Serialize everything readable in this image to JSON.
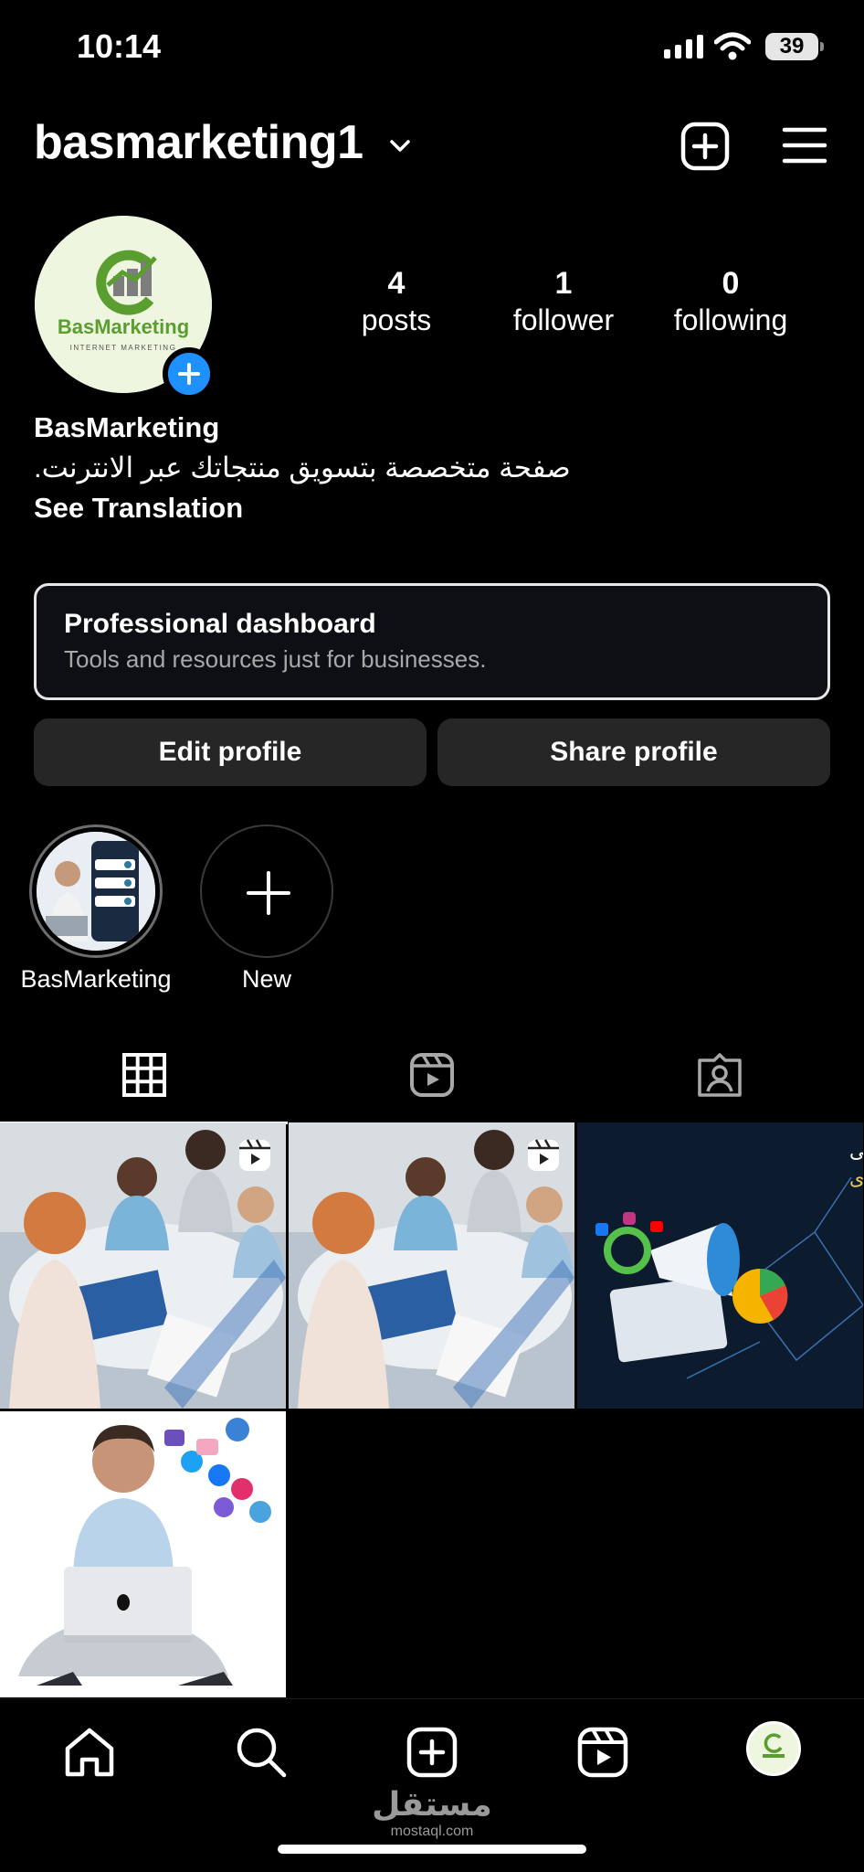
{
  "status_bar": {
    "time": "10:14",
    "battery": "39"
  },
  "header": {
    "username": "basmarketing1"
  },
  "profile": {
    "avatar": {
      "brand": "BasMarketing",
      "tagline": "INTERNET MARKETING"
    },
    "stats": [
      {
        "value": "4",
        "label": "posts"
      },
      {
        "value": "1",
        "label": "follower"
      },
      {
        "value": "0",
        "label": "following"
      }
    ],
    "display_name": "BasMarketing",
    "bio": "صفحة متخصصة بتسويق منتجاتك عبر الانترنت.",
    "see_translation": "See Translation"
  },
  "dashboard": {
    "title": "Professional dashboard",
    "subtitle": "Tools and resources just for businesses."
  },
  "buttons": {
    "edit": "Edit profile",
    "share": "Share profile"
  },
  "highlights": [
    {
      "label": "BasMarketing"
    },
    {
      "label": "New"
    }
  ],
  "posts": [
    {
      "type": "reel"
    },
    {
      "type": "reel"
    },
    {
      "type": "image",
      "caption_line1": "دليلك الشامل إلى",
      "caption_line2": "التسويق بالمحتوى"
    },
    {
      "type": "image"
    }
  ],
  "watermark": {
    "arabic": "مستقل",
    "latin": "mostaql.com"
  },
  "colors": {
    "background": "#000000",
    "button": "#262626",
    "accent": "#1e90ff",
    "border": "#e6e6e6"
  }
}
